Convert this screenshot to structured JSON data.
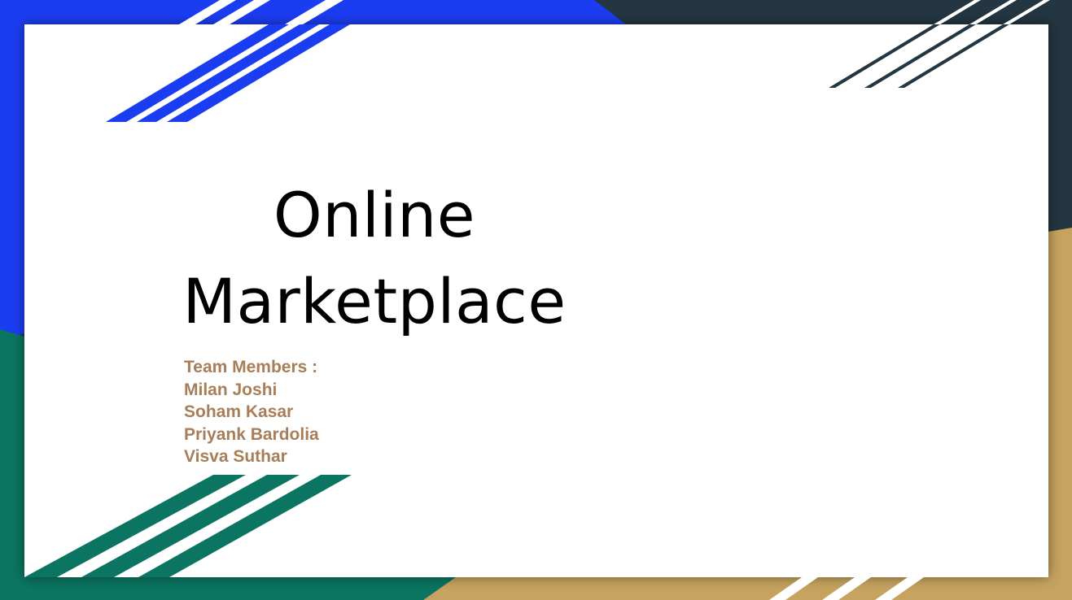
{
  "slide": {
    "title_lines": [
      "Online",
      "Marketplace"
    ],
    "team_heading": "Team Members :",
    "team_members": [
      "Milan Joshi",
      "Soham Kasar",
      "Priyank Bardolia",
      "Visva Suthar"
    ]
  },
  "colors": {
    "blue": "#1b3df2",
    "teal": "#0b7561",
    "dark_slate": "#233641",
    "gold": "#c6a35f",
    "team_text": "#a87e59",
    "title_text": "#000000",
    "card": "#ffffff"
  }
}
